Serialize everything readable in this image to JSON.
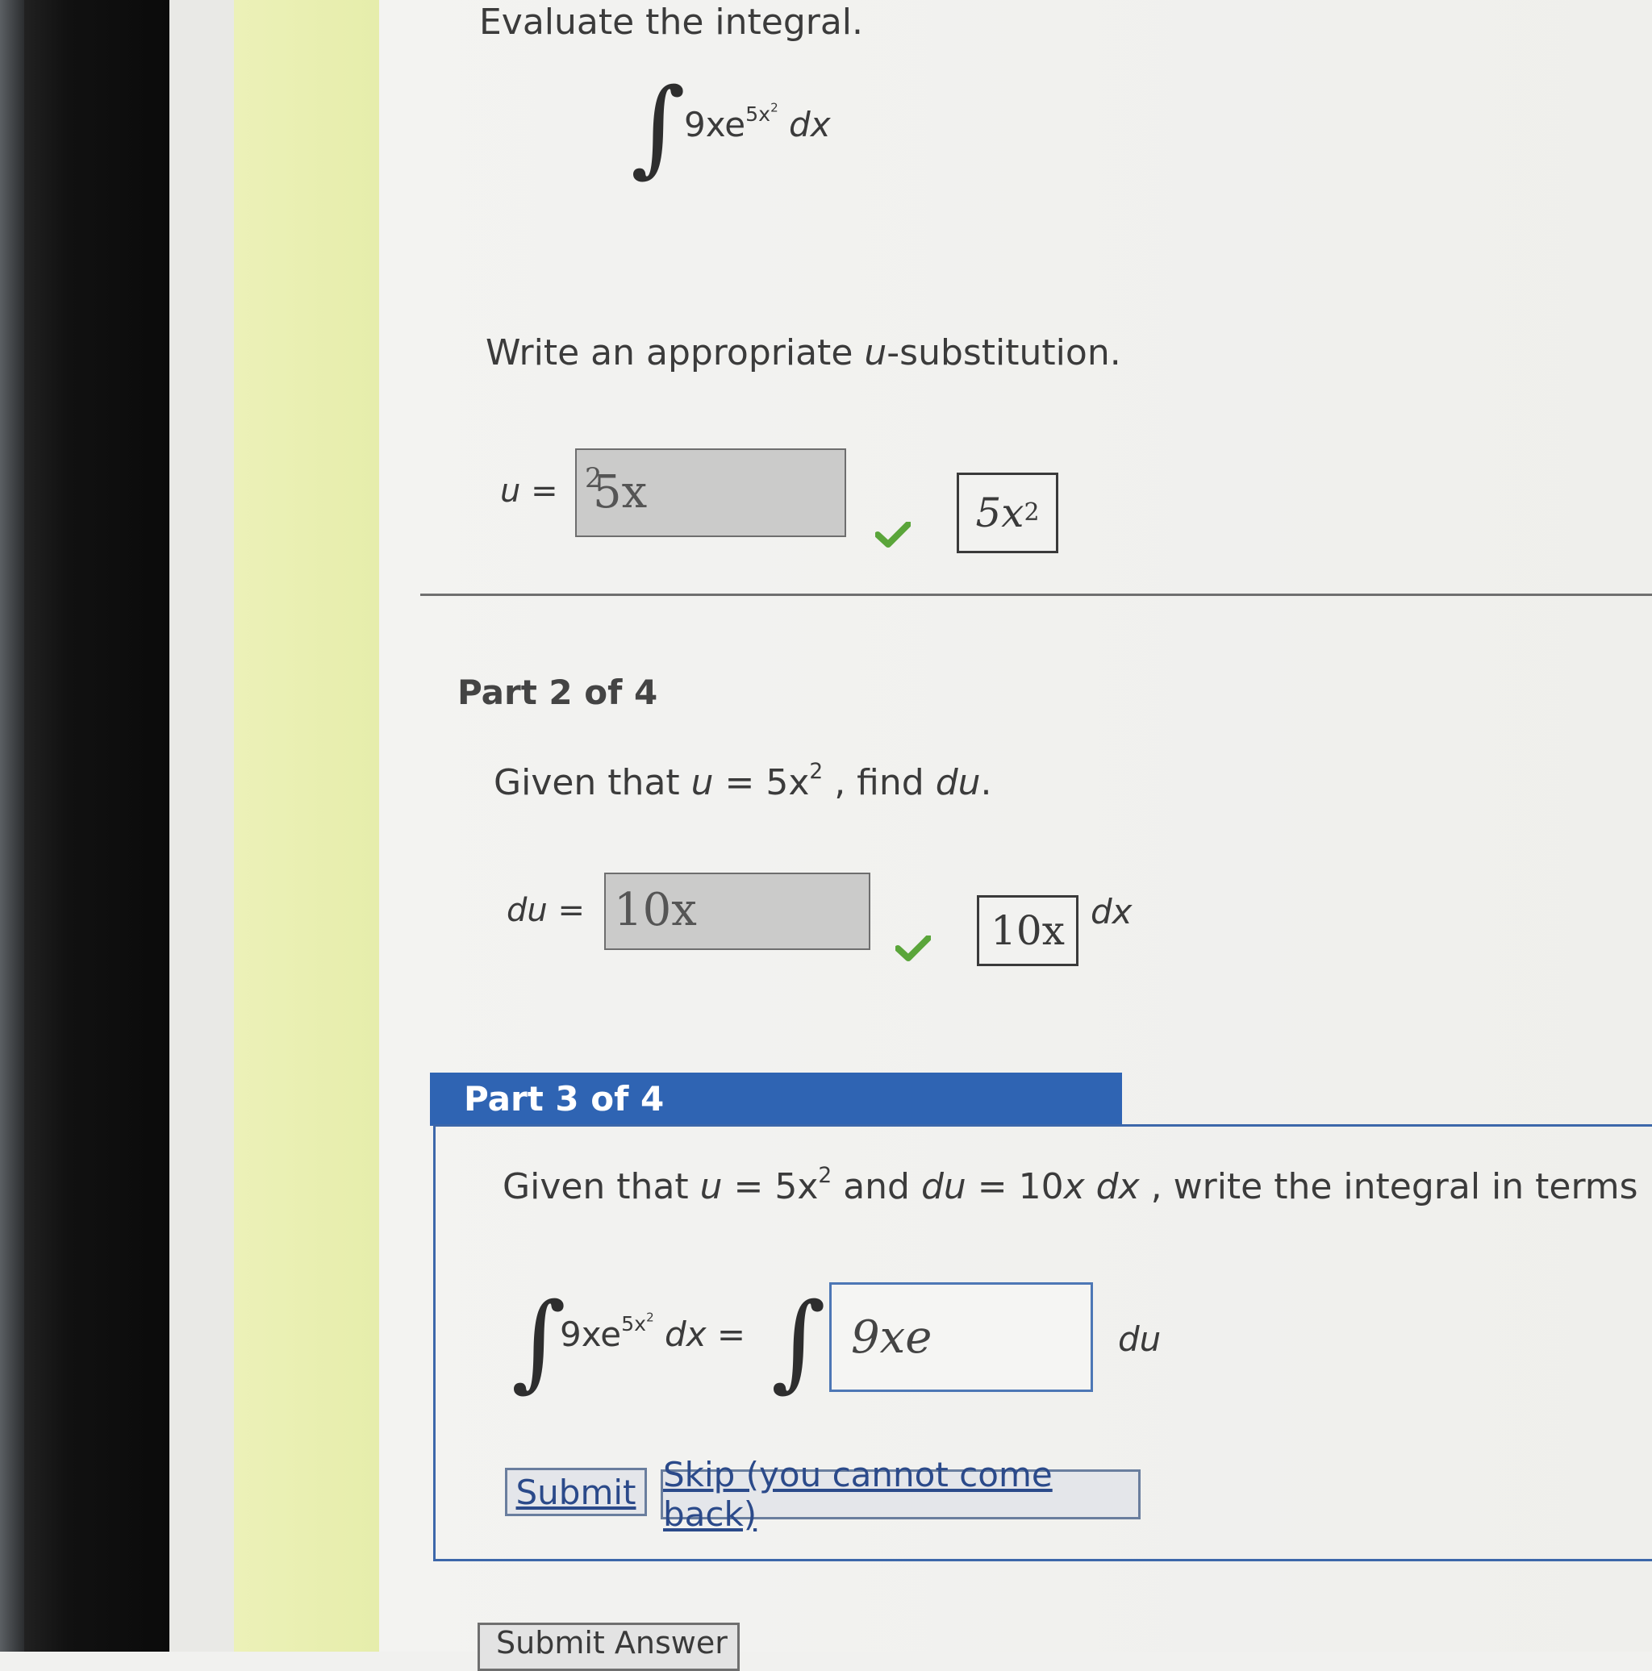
{
  "part1": {
    "instruction": "Evaluate the integral.",
    "integral": {
      "coef": "9xe",
      "exp_base": "5x",
      "exp_pow": "2",
      "dx": "dx"
    },
    "prompt_pre": "Write an appropriate ",
    "prompt_var": "u",
    "prompt_post": "-substitution.",
    "answer_label": "u =",
    "answer_base": "5x",
    "answer_pow": "2",
    "preview_base": "5x",
    "preview_pow": "2"
  },
  "part2": {
    "title": "Part 2 of 4",
    "given_pre": "Given that ",
    "given_u": "u",
    "given_eq": " = 5x",
    "given_pow": "2",
    "given_mid": " , find ",
    "given_du": "du",
    "given_end": ".",
    "answer_label": "du =",
    "answer_value": "10x",
    "preview_value": "10x",
    "suffix": "dx"
  },
  "part3": {
    "title": "Part 3 of 4",
    "given_pre": "Given that ",
    "given_u": "u",
    "given_eq1": " = 5x",
    "given_pow": "2",
    "given_and": " and ",
    "given_du": "du",
    "given_eq2": " = 10",
    "given_x": "x",
    "given_dx": " dx",
    "given_rest": " , write the integral in terms",
    "lhs_coef": "9xe",
    "lhs_exp_base": "5x",
    "lhs_exp_pow": "2",
    "lhs_dx": "dx =",
    "input_value": "9xe",
    "suffix": "du",
    "submit_label": "Submit",
    "skip_label": "Skip (you cannot come back)"
  },
  "footer": {
    "submit_answer_label": "Submit Answer"
  },
  "colors": {
    "header_blue": "#2f64b3",
    "check_green": "#5aa53a",
    "accent_yellow": "#e8eeae"
  }
}
